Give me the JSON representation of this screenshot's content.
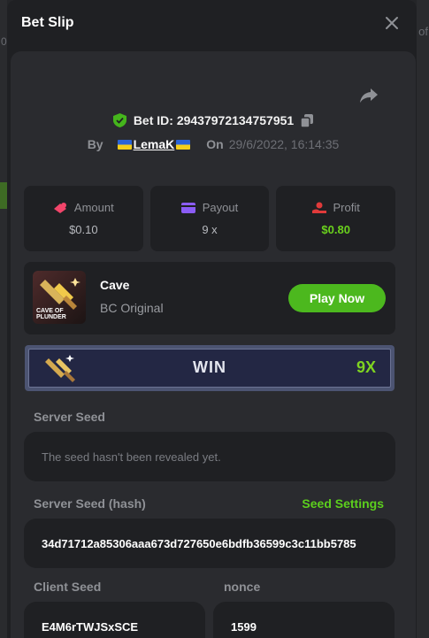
{
  "background": {
    "frag_top": "0",
    "frag_of": "of"
  },
  "modal": {
    "title": "Bet Slip",
    "bet_id_label": "Bet ID: 29437972134757951",
    "by_label": "By",
    "username": "LemaK",
    "on_label": "On",
    "date": "29/6/2022, 16:14:35"
  },
  "stats": [
    {
      "label": "Amount",
      "value": "$0.10",
      "icon": "bet-chip-icon",
      "color": "#f2456a"
    },
    {
      "label": "Payout",
      "value": "9 x",
      "icon": "card-icon",
      "color": "#8b5cf6"
    },
    {
      "label": "Profit",
      "value": "$0.80",
      "icon": "hand-coin-icon",
      "color": "#e03a3a"
    }
  ],
  "game": {
    "name": "Cave",
    "subtitle": "BC Original",
    "thumb_text": "CAVE OF PLUNDER",
    "play_label": "Play Now"
  },
  "result": {
    "label": "WIN",
    "multiplier": "9X"
  },
  "seeds": {
    "server_seed_label": "Server Seed",
    "server_seed_value": "The seed hasn't been revealed yet.",
    "server_hash_label": "Server Seed (hash)",
    "seed_settings_label": "Seed Settings",
    "server_hash_value": "34d71712a85306aaa673d727650e6bdfb36599c3c11bb5785",
    "client_seed_label": "Client Seed",
    "client_seed_value": "E4M6rTWJSxSCE",
    "nonce_label": "nonce",
    "nonce_value": "1599"
  },
  "colors": {
    "accent_green": "#4cb81e",
    "win_green": "#7ed321"
  }
}
